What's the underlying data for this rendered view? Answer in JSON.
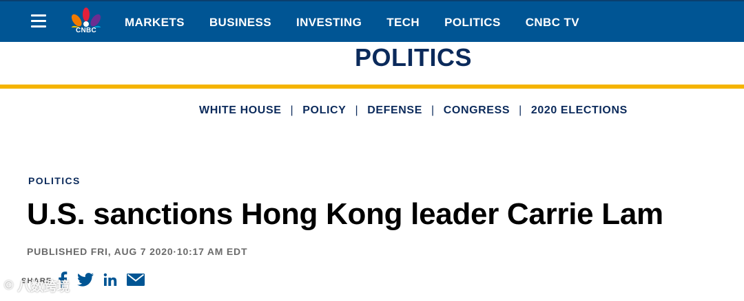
{
  "topnav": {
    "logo_text": "CNBC",
    "items": [
      "MARKETS",
      "BUSINESS",
      "INVESTING",
      "TECH",
      "POLITICS",
      "CNBC TV"
    ]
  },
  "section": {
    "title": "POLITICS"
  },
  "subnav": {
    "items": [
      "WHITE HOUSE",
      "POLICY",
      "DEFENSE",
      "CONGRESS",
      "2020 ELECTIONS"
    ],
    "separator": "|"
  },
  "article": {
    "kicker": "POLITICS",
    "headline": "U.S. sanctions Hong Kong leader Carrie Lam",
    "published": "PUBLISHED FRI, AUG 7 2020·10:17 AM EDT"
  },
  "share": {
    "label": "SHARE",
    "icons": [
      "facebook-icon",
      "twitter-icon",
      "linkedin-icon",
      "email-icon"
    ]
  },
  "watermark": {
    "logo": "©",
    "text": "八数跨境"
  },
  "colors": {
    "topbar": "#005594",
    "navy": "#0b2a5b",
    "gold": "#f5b400",
    "headline": "#000000",
    "meta": "#6a6a6a"
  }
}
